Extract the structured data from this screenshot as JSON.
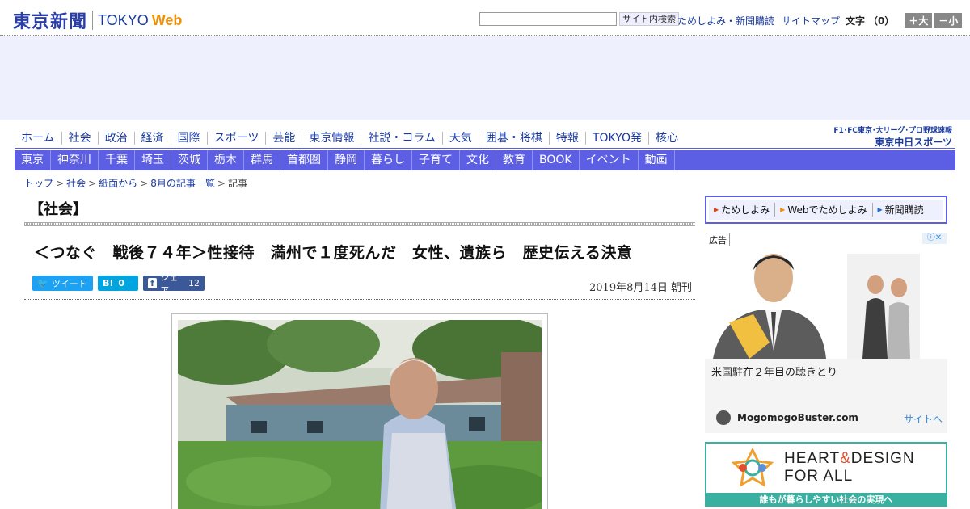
{
  "header": {
    "logo_jp": "東京新聞",
    "logo_tokyo": "TOKYO",
    "logo_web": "Web",
    "search_placeholder": "",
    "search_button": "サイト内検索",
    "links": [
      "ためしよみ・新聞購読",
      "サイトマップ"
    ],
    "font_label": "文字",
    "font_count": "（0）",
    "font_bigger": "＋大",
    "font_smaller": "－小"
  },
  "nav_primary": [
    "ホーム",
    "社会",
    "政治",
    "経済",
    "国際",
    "スポーツ",
    "芸能",
    "東京情報",
    "社説・コラム",
    "天気",
    "囲碁・将棋",
    "特報",
    "TOKYO発",
    "核心"
  ],
  "chunichi": {
    "top": "F1･FC東京･大リーグ･プロ野球速報",
    "bottom": "東京中日スポーツ"
  },
  "nav_secondary": [
    "東京",
    "神奈川",
    "千葉",
    "埼玉",
    "茨城",
    "栃木",
    "群馬",
    "首都圏",
    "静岡",
    "暮らし",
    "子育て",
    "文化",
    "教育",
    "BOOK",
    "イベント",
    "動画"
  ],
  "breadcrumb": {
    "items": [
      "トップ",
      "社会",
      "紙面から",
      "8月の記事一覧"
    ],
    "current": "記事"
  },
  "article": {
    "section": "【社会】",
    "headline": "＜つなぐ　戦後７４年＞性接待　満州で１度死んだ　女性、遺族ら　歴史伝える決意",
    "date": "2019年8月14日 朝刊",
    "social": {
      "tweet_label": "ツイート",
      "hatena_label": "B!",
      "hatena_count": "0",
      "share_label": "シェア",
      "share_count": "12"
    }
  },
  "sidebar": {
    "buttons": [
      "ためしよみ",
      "Webでためしよみ",
      "新聞購読"
    ],
    "ad_label": "広告",
    "ad_text": "米国駐在２年目の聴きとり",
    "ad_source": "MogomogoBuster.com",
    "ad_link": "サイトへ",
    "heart_title_1": "HEART",
    "heart_amp": "&",
    "heart_title_2": "DESIGN",
    "heart_title_3": "FOR ALL",
    "heart_sub": "誰もが暮らしやすい社会の実現へ"
  },
  "colors": {
    "brand_blue": "#2a3ea8",
    "nav_purple": "#5c5fe4",
    "ad_bg": "#eef0fd",
    "orange": "#f29000"
  }
}
